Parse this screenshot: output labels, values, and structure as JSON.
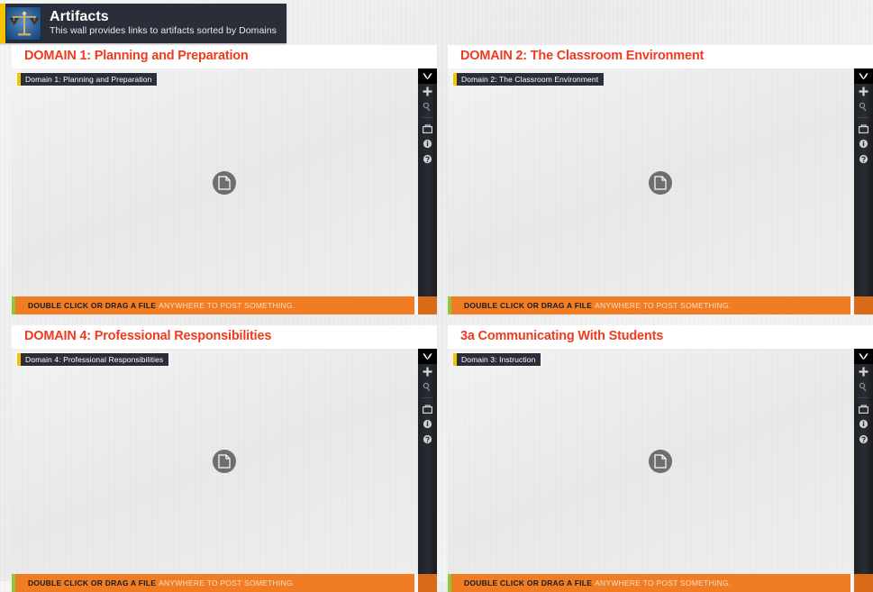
{
  "header": {
    "title": "Artifacts",
    "subtitle": "This wall provides links to artifacts sorted by Domains",
    "logo_icon": "scales-of-justice-icon",
    "accent_color": "#f5c400",
    "background_color": "#2b2e38"
  },
  "theme": {
    "title_color": "#ef3b1f",
    "footer_color": "#f07d24",
    "footer_accent_color": "#8dc63f",
    "tag_accent_color": "#f5c400",
    "toolbar_color": "#1f2128"
  },
  "toolbar": {
    "buttons": [
      {
        "name": "collapse-wall-icon",
        "label": "Collapse",
        "icon": "chevron-down-icon"
      },
      {
        "name": "add-post-icon",
        "label": "Add",
        "icon": "plus-icon"
      },
      {
        "name": "search-icon",
        "label": "Search",
        "icon": "magnifier-icon"
      },
      {
        "name": "share-icon",
        "label": "Share",
        "icon": "share-export-icon"
      },
      {
        "name": "info-icon",
        "label": "Info",
        "icon": "info-circle-icon"
      },
      {
        "name": "help-icon",
        "label": "Help",
        "icon": "question-circle-icon"
      }
    ]
  },
  "footer": {
    "strong_text": "DOUBLE CLICK OR DRAG A FILE",
    "light_text": "ANYWHERE TO POST SOMETHING."
  },
  "placeholder": {
    "icon": "document-icon"
  },
  "panels": [
    {
      "title": "DOMAIN 1: Planning and Preparation",
      "tag": "Domain 1: Planning and Preparation"
    },
    {
      "title": "DOMAIN 2: The Classroom Environment",
      "tag": "Domain 2: The Classroom Environment"
    },
    {
      "title": "DOMAIN 4: Professional Responsibilities",
      "tag": "Domain 4: Professional Responsibilities"
    },
    {
      "title": "3a Communicating With Students",
      "tag": "Domain 3: Instruction"
    }
  ]
}
